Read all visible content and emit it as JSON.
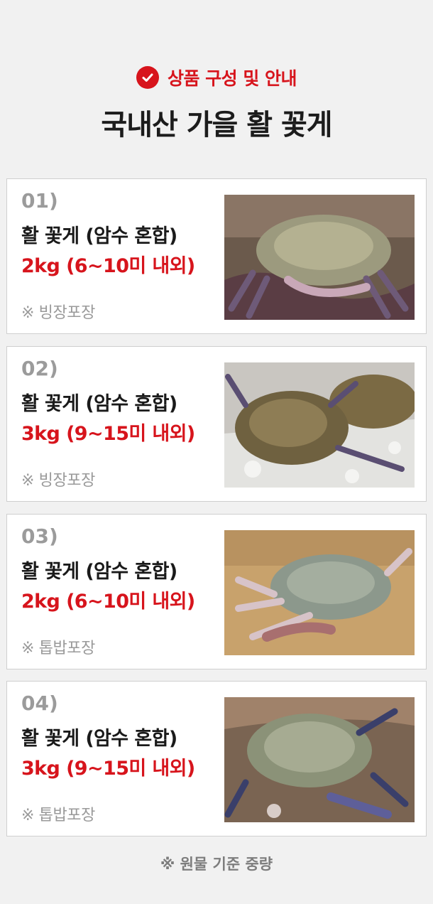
{
  "header": {
    "subtitle": "상품 구성 및 안내",
    "title": "국내산 가을 활 꽃게"
  },
  "items": [
    {
      "num": "01)",
      "name": "활 꽃게 (암수 혼합)",
      "weight": "2kg (6~10미 내외)",
      "pack": "※ 빙장포장",
      "photo_icon": "crab-on-hands-photo"
    },
    {
      "num": "02)",
      "name": "활 꽃게 (암수 혼합)",
      "weight": "3kg (9~15미 내외)",
      "pack": "※ 빙장포장",
      "photo_icon": "crab-on-ice-photo"
    },
    {
      "num": "03)",
      "name": "활 꽃게 (암수 혼합)",
      "weight": "2kg (6~10미 내외)",
      "pack": "※ 톱밥포장",
      "photo_icon": "crab-in-sawdust-photo"
    },
    {
      "num": "04)",
      "name": "활 꽃게 (암수 혼합)",
      "weight": "3kg (9~15미 내외)",
      "pack": "※ 톱밥포장",
      "photo_icon": "crab-on-hands-photo"
    }
  ],
  "footnote": "※ 원물 기준 중량",
  "colors": {
    "accent": "#d7141c",
    "title": "#1c1c1c",
    "muted": "#9a9a9a",
    "background": "#f1f1f1"
  }
}
